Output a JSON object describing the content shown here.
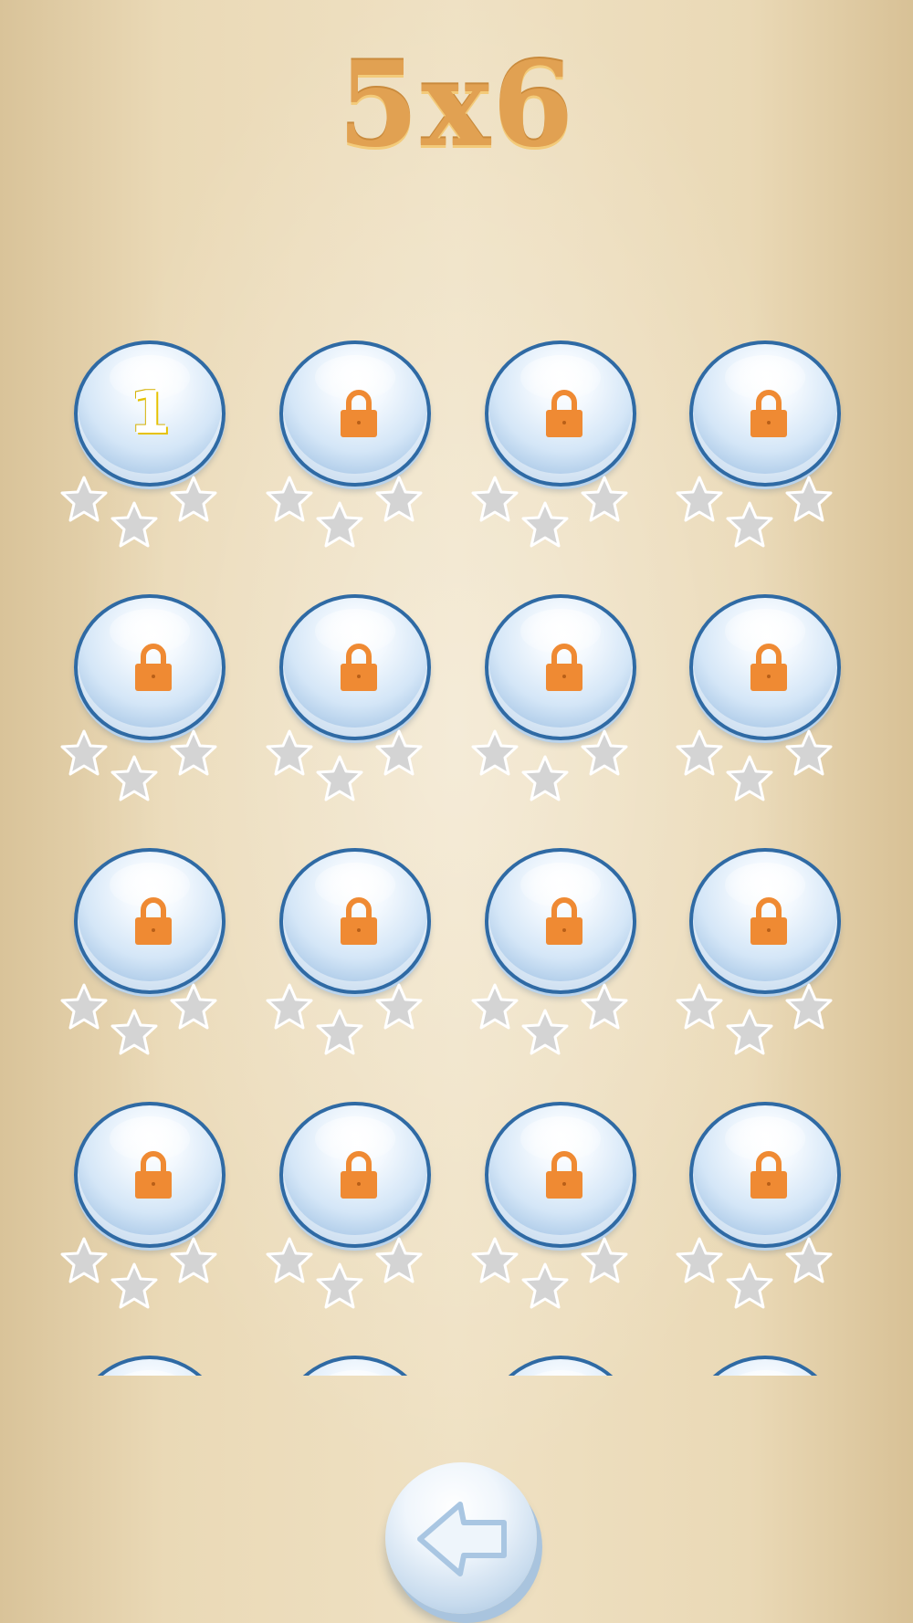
{
  "title": "5x6",
  "levels": [
    {
      "label": "1",
      "locked": false,
      "stars": 0
    },
    {
      "label": "",
      "locked": true,
      "stars": 0
    },
    {
      "label": "",
      "locked": true,
      "stars": 0
    },
    {
      "label": "",
      "locked": true,
      "stars": 0
    },
    {
      "label": "",
      "locked": true,
      "stars": 0
    },
    {
      "label": "",
      "locked": true,
      "stars": 0
    },
    {
      "label": "",
      "locked": true,
      "stars": 0
    },
    {
      "label": "",
      "locked": true,
      "stars": 0
    },
    {
      "label": "",
      "locked": true,
      "stars": 0
    },
    {
      "label": "",
      "locked": true,
      "stars": 0
    },
    {
      "label": "",
      "locked": true,
      "stars": 0
    },
    {
      "label": "",
      "locked": true,
      "stars": 0
    },
    {
      "label": "",
      "locked": true,
      "stars": 0
    },
    {
      "label": "",
      "locked": true,
      "stars": 0
    },
    {
      "label": "",
      "locked": true,
      "stars": 0
    },
    {
      "label": "",
      "locked": true,
      "stars": 0
    },
    {
      "label": "",
      "locked": true,
      "stars": 0
    },
    {
      "label": "",
      "locked": true,
      "stars": 0
    },
    {
      "label": "",
      "locked": true,
      "stars": 0
    },
    {
      "label": "",
      "locked": true,
      "stars": 0
    }
  ],
  "back_button": {
    "icon": "back-arrow-icon"
  },
  "colors": {
    "title": "#e1a152",
    "lock": "#ef8a33",
    "bubble_border": "#2f6aa4",
    "star_empty": "#d4d4d4",
    "star_earned": "#f5c518"
  }
}
